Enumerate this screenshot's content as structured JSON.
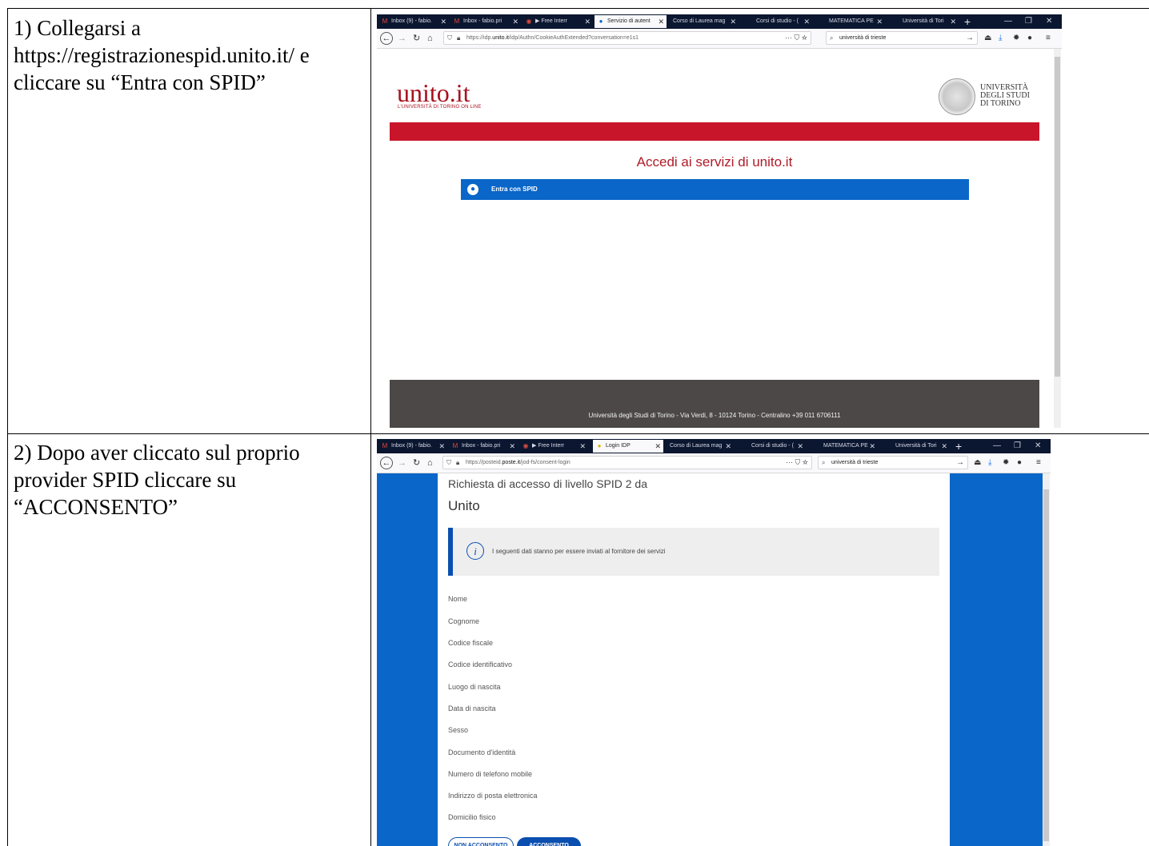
{
  "steps": [
    {
      "text": "1) Collegarsi a https://registrazionespid.unito.it/ e cliccare su “Entra con SPID”"
    },
    {
      "text": "2) Dopo aver cliccato sul proprio provider SPID cliccare su “ACCONSENTO”"
    }
  ],
  "shot1": {
    "tabs": [
      {
        "label": "Inbox (9) - fabio.",
        "icon": "gmail-icon"
      },
      {
        "label": "Inbox - fabio.pri",
        "icon": "gmail-icon"
      },
      {
        "label": "▶ Free Interr",
        "icon": "media-icon"
      },
      {
        "label": "Servizio di autent",
        "icon": "spid-icon"
      },
      {
        "label": "Corso di Laurea mag",
        "icon": ""
      },
      {
        "label": "Corsi di studio - (",
        "icon": ""
      },
      {
        "label": "MATEMATICA PE",
        "icon": ""
      },
      {
        "label": "Università di Tori",
        "icon": ""
      }
    ],
    "url_prefix": "https://idp.",
    "url_host": "unito.it",
    "url_rest": "/idp/Authn/CookieAuthExtended?conversation=e1s1",
    "search_value": "università di trieste",
    "logo": "unito.it",
    "logo_sub": "L'UNIVERSITÀ DI TORINO ON LINE",
    "uni_name": [
      "UNIVERSITÀ",
      "DEGLI STUDI",
      "DI TORINO"
    ],
    "access_title": "Accedi ai servizi di unito.it",
    "spid_button": "Entra con SPID",
    "footer": "Università degli Studi di Torino - Via Verdi, 8 - 10124 Torino - Centralino +39 011 6706111"
  },
  "shot2": {
    "tabs": [
      {
        "label": "Inbox (9) - fabio.",
        "icon": "gmail-icon"
      },
      {
        "label": "Inbox - fabio.pri",
        "icon": "gmail-icon"
      },
      {
        "label": "▶ Free Interr",
        "icon": "media-icon"
      },
      {
        "label": "Login IDP",
        "icon": "poste-icon"
      },
      {
        "label": "Corso di Laurea mag",
        "icon": ""
      },
      {
        "label": "Corsi di studio - (",
        "icon": ""
      },
      {
        "label": "MATEMATICA PE",
        "icon": ""
      },
      {
        "label": "Università di Tori",
        "icon": ""
      }
    ],
    "url_prefix": "https://posteid.",
    "url_host": "poste.it",
    "url_rest": "/jod-fs/consent-login",
    "search_value": "università di trieste",
    "request_title": "Richiesta di accesso di livello SPID 2 da",
    "request_org": "Unito",
    "info_text": "I seguenti dati stanno per essere inviati al fornitore dei servizi",
    "fields": [
      "Nome",
      "Cognome",
      "Codice fiscale",
      "Codice identificativo",
      "Luogo di nascita",
      "Data di nascita",
      "Sesso",
      "Documento d'identità",
      "Numero di telefono mobile",
      "Indirizzo di posta elettronica",
      "Domicilio fisico"
    ],
    "deny_button": "NON ACCONSENTO",
    "accept_button": "ACCONSENTO"
  }
}
